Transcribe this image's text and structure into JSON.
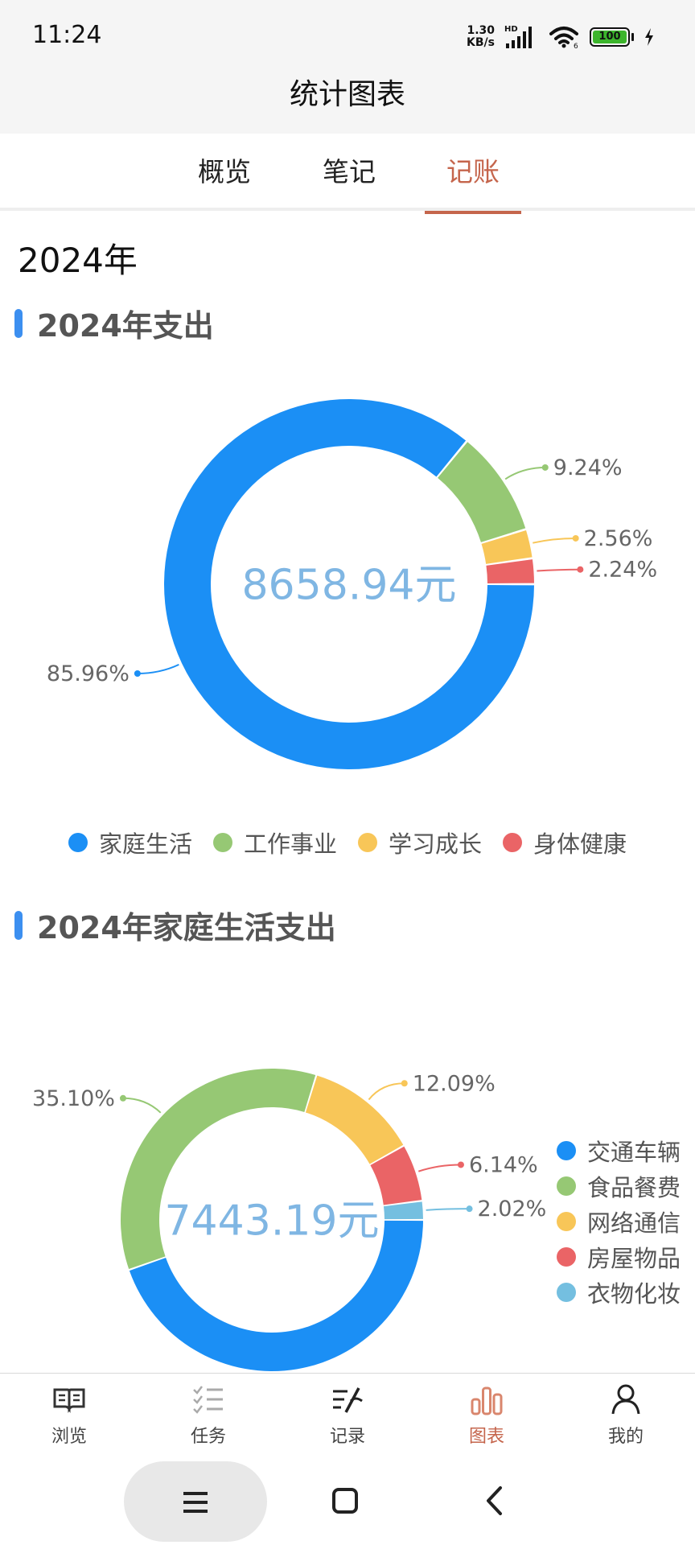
{
  "status_bar": {
    "time": "11:24",
    "net_speed_value": "1.30",
    "net_speed_unit": "KB/s",
    "signal_label": "HD",
    "battery": "100"
  },
  "header": {
    "title": "统计图表"
  },
  "tabs": [
    {
      "label": "概览",
      "active": false
    },
    {
      "label": "笔记",
      "active": false
    },
    {
      "label": "记账",
      "active": true
    }
  ],
  "year_label": "2024年",
  "sections": [
    {
      "title": "2024年支出"
    },
    {
      "title": "2024年家庭生活支出"
    }
  ],
  "chart_data": [
    {
      "type": "pie",
      "title": "2024年支出",
      "center_label": "8658.94元",
      "total": 8658.94,
      "series": [
        {
          "name": "家庭生活",
          "value": 85.96,
          "label": "85.96%",
          "color": "#1b8ff5"
        },
        {
          "name": "工作事业",
          "value": 9.24,
          "label": "9.24%",
          "color": "#96c874"
        },
        {
          "name": "学习成长",
          "value": 2.56,
          "label": "2.56%",
          "color": "#f8c658"
        },
        {
          "name": "身体健康",
          "value": 2.24,
          "label": "2.24%",
          "color": "#ea6466"
        }
      ],
      "legend_position": "bottom"
    },
    {
      "type": "pie",
      "title": "2024年家庭生活支出",
      "center_label": "7443.19元",
      "total": 7443.19,
      "series": [
        {
          "name": "交通车辆",
          "value": 44.65,
          "label": "",
          "color": "#1b8ff5"
        },
        {
          "name": "食品餐费",
          "value": 35.1,
          "label": "35.10%",
          "color": "#96c874"
        },
        {
          "name": "网络通信",
          "value": 12.09,
          "label": "12.09%",
          "color": "#f8c658"
        },
        {
          "name": "房屋物品",
          "value": 6.14,
          "label": "6.14%",
          "color": "#ea6466"
        },
        {
          "name": "衣物化妆",
          "value": 2.02,
          "label": "2.02%",
          "color": "#74bfe0"
        }
      ],
      "legend_position": "right"
    }
  ],
  "bottom_nav": [
    {
      "label": "浏览",
      "icon": "book-icon",
      "active": false
    },
    {
      "label": "任务",
      "icon": "checklist-icon",
      "active": false
    },
    {
      "label": "记录",
      "icon": "pen-lines-icon",
      "active": false
    },
    {
      "label": "图表",
      "icon": "bar-chart-icon",
      "active": true
    },
    {
      "label": "我的",
      "icon": "person-icon",
      "active": false
    }
  ]
}
